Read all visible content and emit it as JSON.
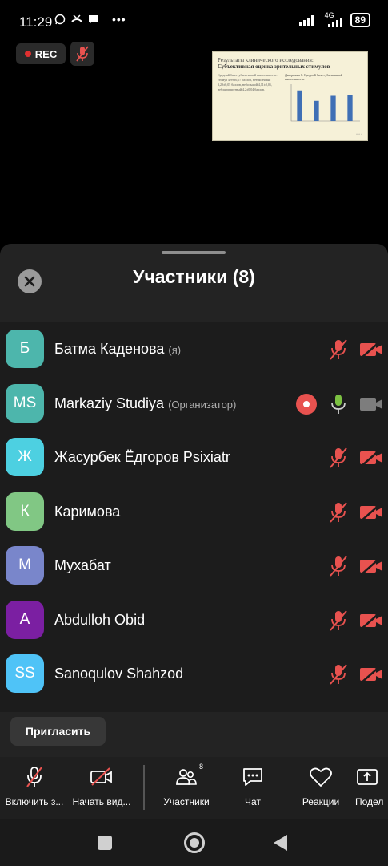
{
  "status_bar": {
    "time": "11:29",
    "network": "4G",
    "battery": "89"
  },
  "recording": {
    "rec_label": "REC"
  },
  "slide": {
    "title_line1": "Результаты клинического исследования:",
    "title_line2": "Субъективная оценка зрительных стимулов",
    "body_text": "Средний балл субъективной выносливости: стимул 4,99±0,07 баллов, нетоксичный 3,29±0,05 баллов, небольшой 4,11±0,05, неблагоприятный 4,2±0,04 баллов.",
    "chart_title": "Диаграмма 1. Средний балл субъективной выносливости",
    "chart_data": {
      "type": "bar",
      "categories": [
        "",
        "",
        "",
        ""
      ],
      "values": [
        4.99,
        3.29,
        4.11,
        4.2
      ],
      "ylim": [
        0,
        6
      ]
    }
  },
  "participants_panel": {
    "title": "Участники (8)",
    "participants": [
      {
        "initials": "Б",
        "name": "Батма Каденова",
        "role": "(я)",
        "color": "#4db6ac",
        "mic": "muted",
        "cam": "off"
      },
      {
        "initials": "MS",
        "name": "Markaziy Studiya",
        "role": "(Организатор)",
        "color": "#4db6ac",
        "mic": "on",
        "cam": "on",
        "recording": true
      },
      {
        "initials": "Ж",
        "name": "Жасурбек Ёдгоров Psixiatr",
        "role": "",
        "color": "#4dd0e1",
        "mic": "muted",
        "cam": "off"
      },
      {
        "initials": "К",
        "name": "Каримова",
        "role": "",
        "color": "#81c784",
        "mic": "muted",
        "cam": "off"
      },
      {
        "initials": "М",
        "name": "Мухабат",
        "role": "",
        "color": "#7986cb",
        "mic": "muted",
        "cam": "off"
      },
      {
        "initials": "A",
        "name": "Abdulloh Obid",
        "role": "",
        "color": "#7b1fa2",
        "mic": "muted",
        "cam": "off"
      },
      {
        "initials": "SS",
        "name": "Sanoqulov Shahzod",
        "role": "",
        "color": "#4fc3f7",
        "mic": "muted",
        "cam": "off"
      }
    ],
    "invite_label": "Пригласить"
  },
  "toolbar": {
    "unmute_label": "Включить з...",
    "start_video_label": "Начать вид...",
    "participants_label": "Участники",
    "participants_count": "8",
    "chat_label": "Чат",
    "reactions_label": "Реакции",
    "share_label": "Подел"
  },
  "colors": {
    "muted_red": "#e8524f",
    "mic_green": "#7cc142",
    "sheet_bg": "#232323"
  }
}
